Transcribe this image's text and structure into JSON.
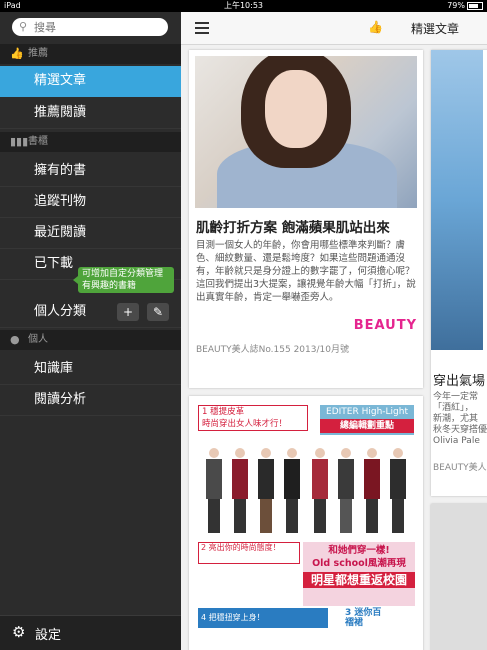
{
  "status": {
    "device": "iPad",
    "time": "上午10:53",
    "battery": "79%"
  },
  "search": {
    "placeholder": "搜尋"
  },
  "sidebar": {
    "sec_recommend": "推薦",
    "featured": "精選文章",
    "recommended_reading": "推薦閱讀",
    "sec_shelf": "書櫃",
    "owned_books": "擁有的書",
    "tracked_periodicals": "追蹤刊物",
    "recently_read": "最近閱讀",
    "downloaded": "已下載",
    "tooltip_line1": "可增加自定分類管理",
    "tooltip_line2": "有興趣的書籍",
    "custom_categories": "個人分類",
    "add_symbol": "+",
    "sec_personal": "個人",
    "knowledge_base": "知識庫",
    "reading_analysis": "閱讀分析",
    "settings": "設定"
  },
  "header": {
    "title": "精選文章"
  },
  "article1": {
    "title": "肌齡打折方案 飽滿蘋果肌站出來",
    "excerpt": "目測一個女人的年齡，你會用哪些標準來判斷？膚色、細紋數量、還是鬆垮度？如果這些問題通通沒有，年齡就只是身分證上的數字罷了，何須擔心呢？這回我們提出3大提案，讓視覺年齡大幅「打折」，說出真實年齡，肯定一舉嚇歪旁人。",
    "brand": "BEAUTY",
    "source": "BEAUTY美人誌No.155  2013/10月號"
  },
  "article2": {
    "h1a": "1 穩提皮革",
    "h1b": "時尚穿出女人味才行！",
    "h2a": "EDITER High-Light",
    "h2b": "總編輯劃重點",
    "s3": "2 亮出你的時尚態度！",
    "big1": "和她們穿一樣!",
    "big2": "Old school風潮再現",
    "big3": "明星都想重返校園",
    "s4": "4 把穩扭穿上身！",
    "s5": "3 迷你百褶裙"
  },
  "article3": {
    "title": "穿出氣場",
    "ex1": "今年一定常",
    "ex2": "「酒紅」，",
    "ex3": "新潮，尤其",
    "ex4": "秋冬天穿搭優",
    "ex5": "Olivia Pale",
    "source": "BEAUTY美人"
  },
  "colors": {
    "accent": "#39a6dd",
    "tooltip": "#4fa43b",
    "brand": "#e5258f"
  }
}
